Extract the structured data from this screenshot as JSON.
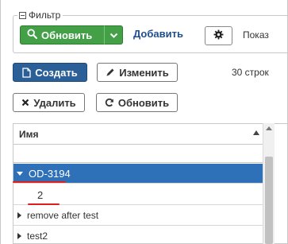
{
  "filter": {
    "legend": "Фильтр",
    "refresh_label": "Обновить",
    "add_label": "Добавить",
    "show_label": "Показ"
  },
  "actions": {
    "create_label": "Создать",
    "edit_label": "Изменить",
    "delete_label": "Удалить",
    "update_label": "Обновить",
    "row_count": "30 строк"
  },
  "table": {
    "column_header": "Имя",
    "rows": [
      {
        "label": "OD-3194",
        "expanded": true,
        "selected": true
      },
      {
        "label": "2",
        "child": true
      },
      {
        "label": "remove after test",
        "expanded": false
      },
      {
        "label": "test2",
        "expanded": false
      }
    ]
  },
  "colors": {
    "accent_green": "#43a047",
    "primary_blue": "#2b5f97",
    "selected_row": "#2f71b8",
    "annotation_red": "#e01e1e"
  }
}
